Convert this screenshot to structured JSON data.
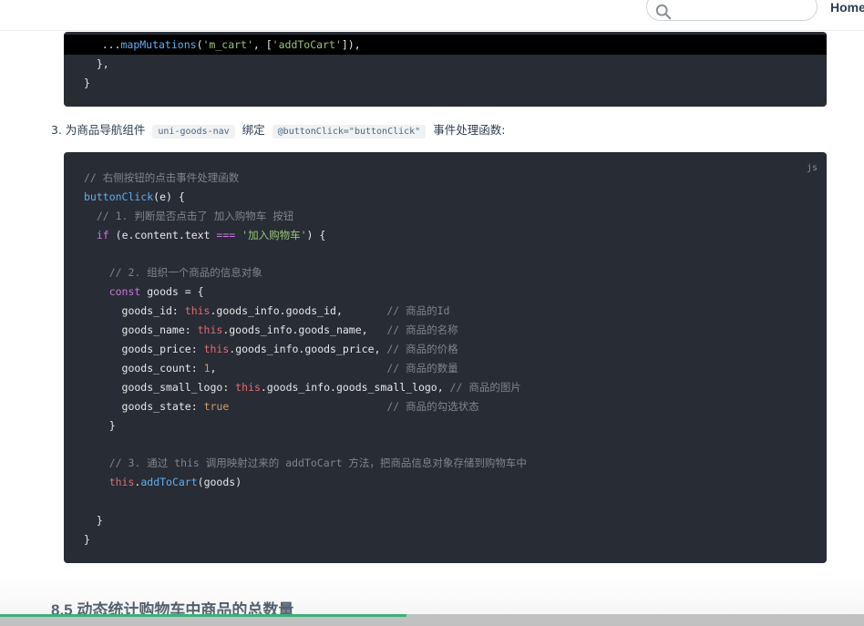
{
  "topbar": {
    "search_placeholder": "",
    "nav_home": "Home",
    "search_icon": "search-icon"
  },
  "top_code": {
    "lines": [
      "    ...mapMutations('m_cart', ['addToCart']),",
      "  },",
      "}"
    ]
  },
  "step3": {
    "prefix": "3. 为商品导航组件",
    "component": "uni-goods-nav",
    "middle": "绑定",
    "binding": "@buttonClick=\"buttonClick\"",
    "suffix": "事件处理函数:"
  },
  "main_code": {
    "lang": "js",
    "lines": [
      "// 右侧按钮的点击事件处理函数",
      "buttonClick(e) {",
      "  // 1. 判断是否点击了 加入购物车 按钮",
      "  if (e.content.text === '加入购物车') {",
      "",
      "    // 2. 组织一个商品的信息对象",
      "    const goods = {",
      "      goods_id: this.goods_info.goods_id,       // 商品的Id",
      "      goods_name: this.goods_info.goods_name,   // 商品的名称",
      "      goods_price: this.goods_info.goods_price, // 商品的价格",
      "      goods_count: 1,                           // 商品的数量",
      "      goods_small_logo: this.goods_info.goods_small_logo, // 商品的图片",
      "      goods_state: true                         // 商品的勾选状态",
      "    }",
      "",
      "    // 3. 通过 this 调用映射过来的 addToCart 方法，把商品信息对象存储到购物车中",
      "    this.addToCart(goods)",
      "",
      "  }",
      "}"
    ]
  },
  "section_heading": "8.5 动态统计购物车中商品的总数量",
  "video_progress": 0.47,
  "colors": {
    "code_bg": "#282c34",
    "keyword": "#c678dd",
    "function": "#61afef",
    "string": "#98c379",
    "comment": "#7f848e",
    "number": "#d19a66",
    "this": "#e06c75",
    "accent": "#3eaf7c"
  }
}
